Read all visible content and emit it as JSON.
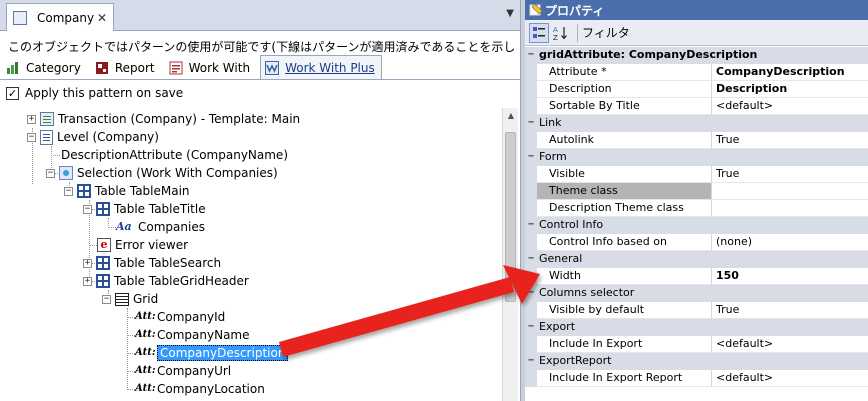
{
  "left": {
    "tab": {
      "title": "Company",
      "close": "✕",
      "dropdown": "▼"
    },
    "description": "このオブジェクトではパターンの使用が可能です(下線はパターンが適用済みであることを示し",
    "pattern_tabs": [
      {
        "label": "Category"
      },
      {
        "label": "Report"
      },
      {
        "label": "Work With"
      },
      {
        "label": "Work With Plus"
      }
    ],
    "apply_label": "Apply this pattern on save",
    "apply_checked": "✓",
    "tree": {
      "transaction": "Transaction (Company) - Template: Main",
      "level": "Level (Company)",
      "description_attribute": "DescriptionAttribute (CompanyName)",
      "selection": "Selection (Work With Companies)",
      "table_main": "Table TableMain",
      "table_title": "Table TableTitle",
      "companies": "Companies",
      "error_viewer": "Error viewer",
      "table_search": "Table TableSearch",
      "table_grid_header": "Table TableGridHeader",
      "grid": "Grid",
      "att_company_id": "CompanyId",
      "att_company_name": "CompanyName",
      "att_company_description": "CompanyDescription",
      "att_company_url": "CompanyUrl",
      "att_company_location": "CompanyLocation"
    },
    "icons": {
      "att": "Att:",
      "aa": "Aa",
      "ev": "e",
      "plus": "+",
      "minus": "−"
    }
  },
  "properties": {
    "title": "プロパティ",
    "toolbar": {
      "categorized": "▤",
      "alpha": "AZ↓",
      "filter": "フィルタ"
    },
    "header": "gridAttribute: CompanyDescription",
    "rows": {
      "attribute_name": "Attribute *",
      "attribute_value": "CompanyDescription",
      "description_name": "Description",
      "description_value": "Description",
      "sortable_name": "Sortable By Title",
      "sortable_value": "<default>",
      "cat_link": "Link",
      "autolink_name": "Autolink",
      "autolink_value": "True",
      "cat_form": "Form",
      "visible_name": "Visible",
      "visible_value": "True",
      "theme_class_name": "Theme class",
      "theme_class_value": "",
      "desc_theme_class_name": "Description Theme class",
      "desc_theme_class_value": "",
      "cat_control_info": "Control Info",
      "control_info_based_name": "Control Info based on",
      "control_info_based_value": "(none)",
      "cat_general": "General",
      "width_name": "Width",
      "width_value": "150",
      "cat_columns_selector": "Columns selector",
      "visible_default_name": "Visible by default",
      "visible_default_value": "True",
      "cat_export": "Export",
      "include_export_name": "Include In Export",
      "include_export_value": "<default>",
      "cat_export_report": "ExportReport",
      "include_export_report_name": "Include In Export Report",
      "include_export_report_value": "<default>"
    },
    "collapse": "−"
  },
  "colors": {
    "accent": "#4a6ea9",
    "selection": "#3399ff",
    "arrow": "#e8231a"
  }
}
